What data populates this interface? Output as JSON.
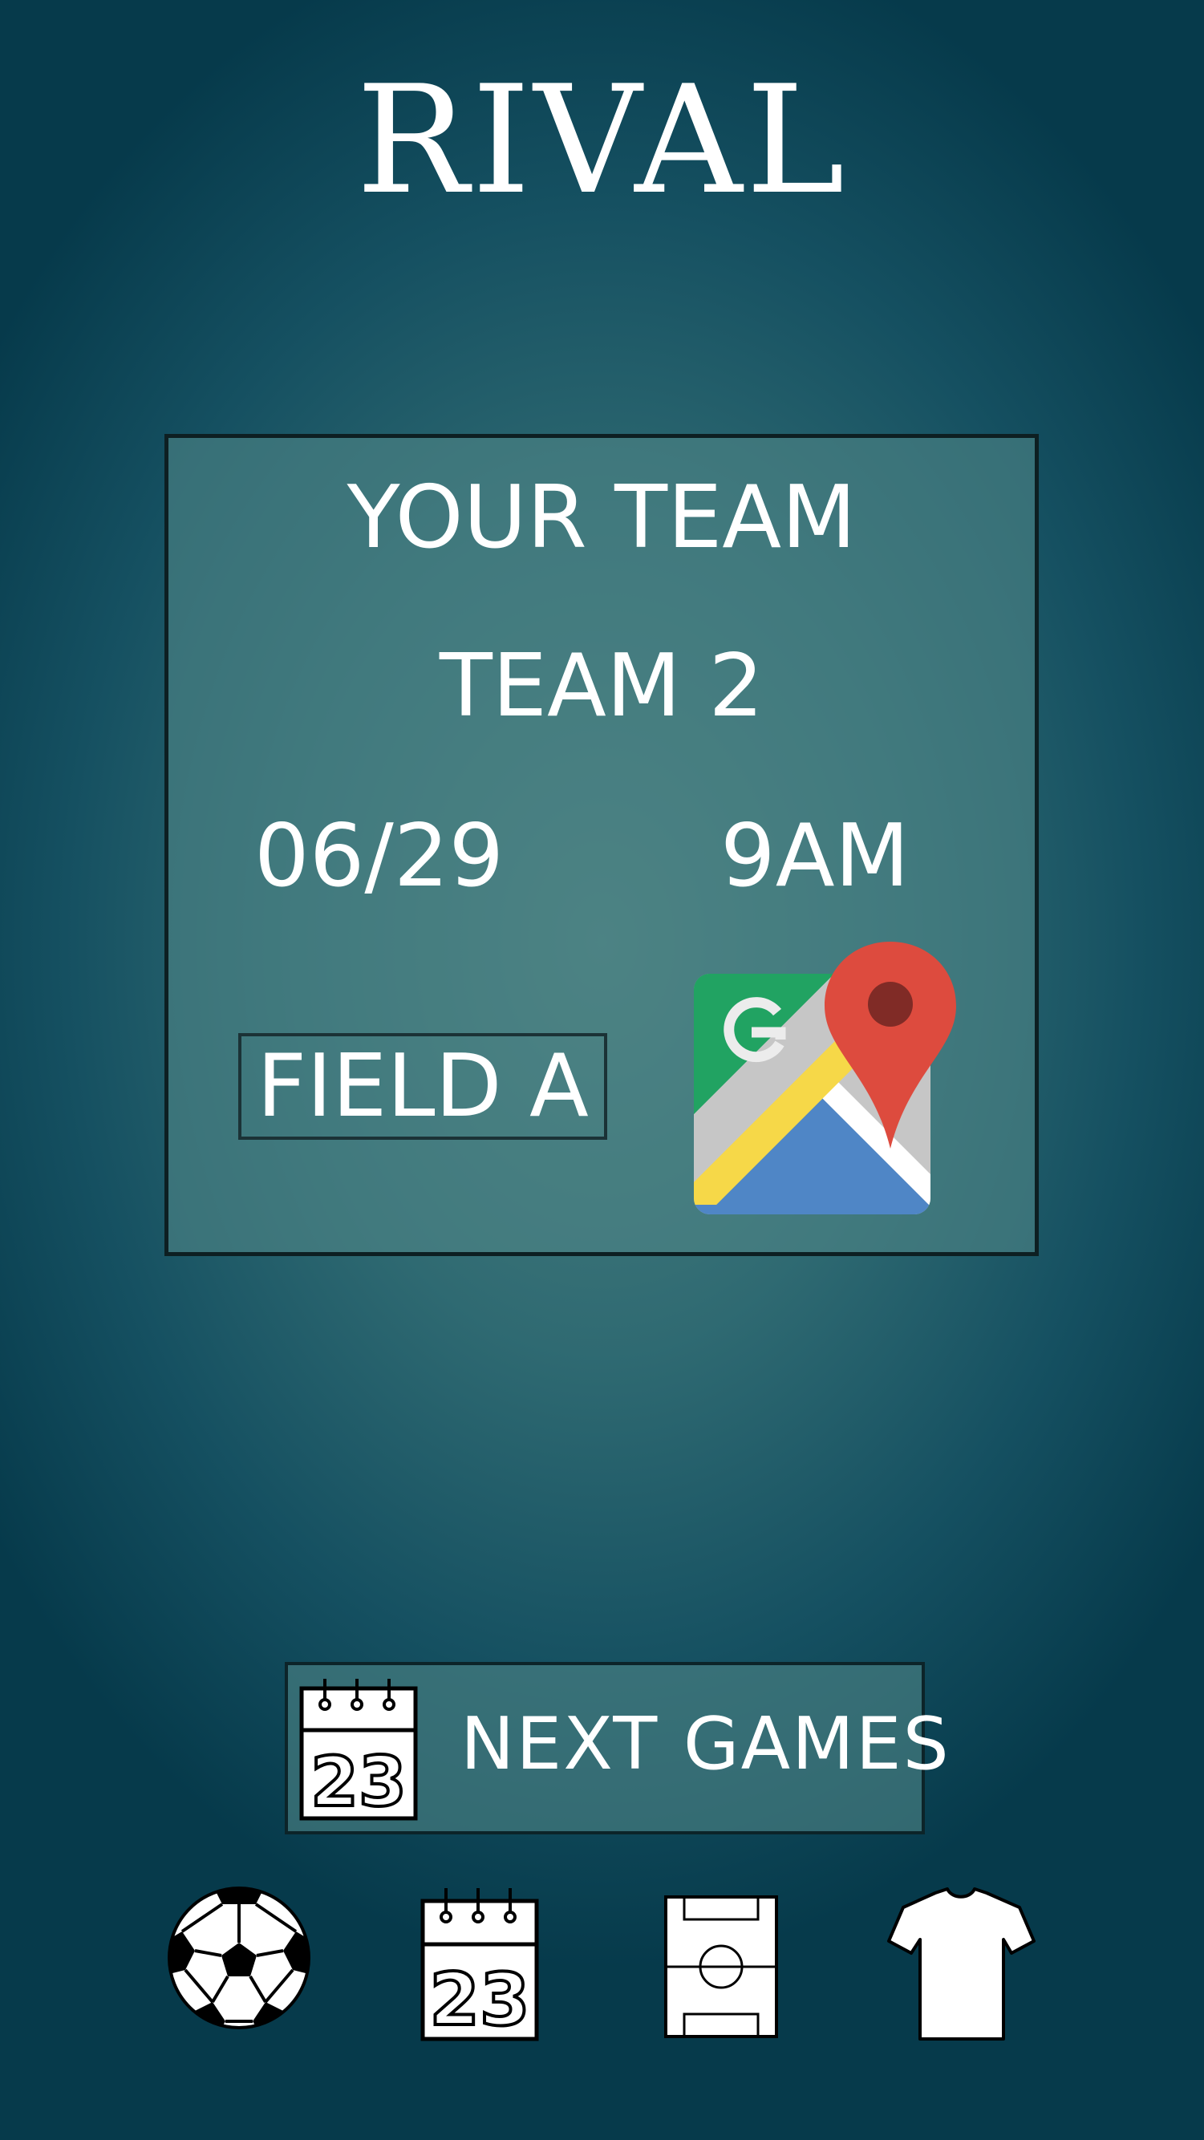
{
  "header": {
    "title": "RIVAL"
  },
  "match": {
    "home_team": "YOUR TEAM",
    "away_team": "TEAM 2",
    "date": "06/29",
    "time": "9AM",
    "field": "FIELD A",
    "map_icon": "google-maps-icon"
  },
  "next_games": {
    "label": "NEXT GAMES",
    "icon": "calendar-icon",
    "icon_number": "23"
  },
  "bottom_nav": {
    "items": [
      {
        "icon": "soccer-ball-icon"
      },
      {
        "icon": "calendar-icon",
        "number": "23"
      },
      {
        "icon": "soccer-field-icon"
      },
      {
        "icon": "jersey-icon"
      }
    ]
  },
  "colors": {
    "background": "#063a4b",
    "card": "#4e8486",
    "maps_green": "#21a362",
    "maps_blue": "#4f86c6",
    "maps_yellow": "#f6d848",
    "maps_red": "#dd4b3e"
  }
}
